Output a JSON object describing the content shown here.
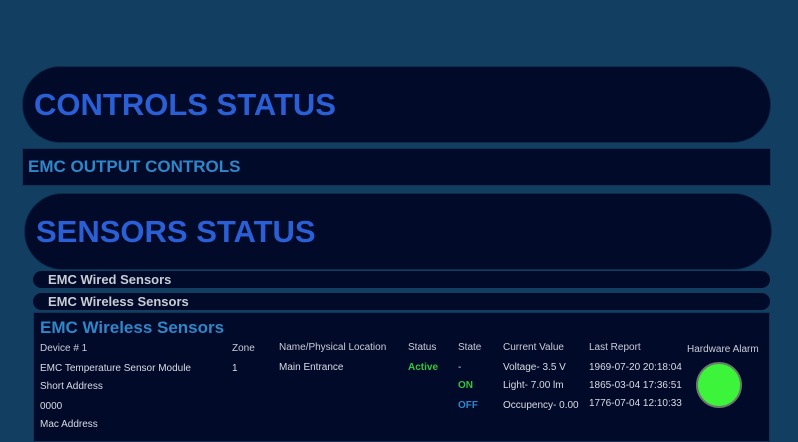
{
  "controls_status": {
    "title": "CONTROLS STATUS"
  },
  "emc_output_controls": {
    "title": "EMC OUTPUT CONTROLS"
  },
  "sensors_status": {
    "title": "SENSORS STATUS"
  },
  "wired_sensors": {
    "label": "EMC Wired Sensors"
  },
  "wireless_sensors": {
    "label": "EMC Wireless Sensors"
  },
  "wireless_panel": {
    "title": "EMC Wireless Sensors",
    "headers": {
      "device": "Device # 1",
      "zone": "Zone",
      "location": "Name/Physical Location",
      "status": "Status",
      "state": "State",
      "current_value": "Current Value",
      "last_report": "Last Report",
      "hardware_alarm": "Hardware Alarm"
    },
    "device_name": "EMC Temperature Sensor Module",
    "short_address_label": "Short Address",
    "short_address_value": "0000",
    "mac_address_label": "Mac Address",
    "zone": "1",
    "location": "Main Entrance",
    "status": "Active",
    "states": [
      "-",
      "ON",
      "OFF"
    ],
    "current_values": [
      "Voltage- 3.5 V",
      "Light- 7.00 lm",
      "Occupency- 0.00"
    ],
    "last_reports": [
      "1969-07-20 20:18:04",
      "1865-03-04 17:36:51",
      "1776-07-04 12:10:33"
    ],
    "alarm_color": "#3cf43a"
  }
}
